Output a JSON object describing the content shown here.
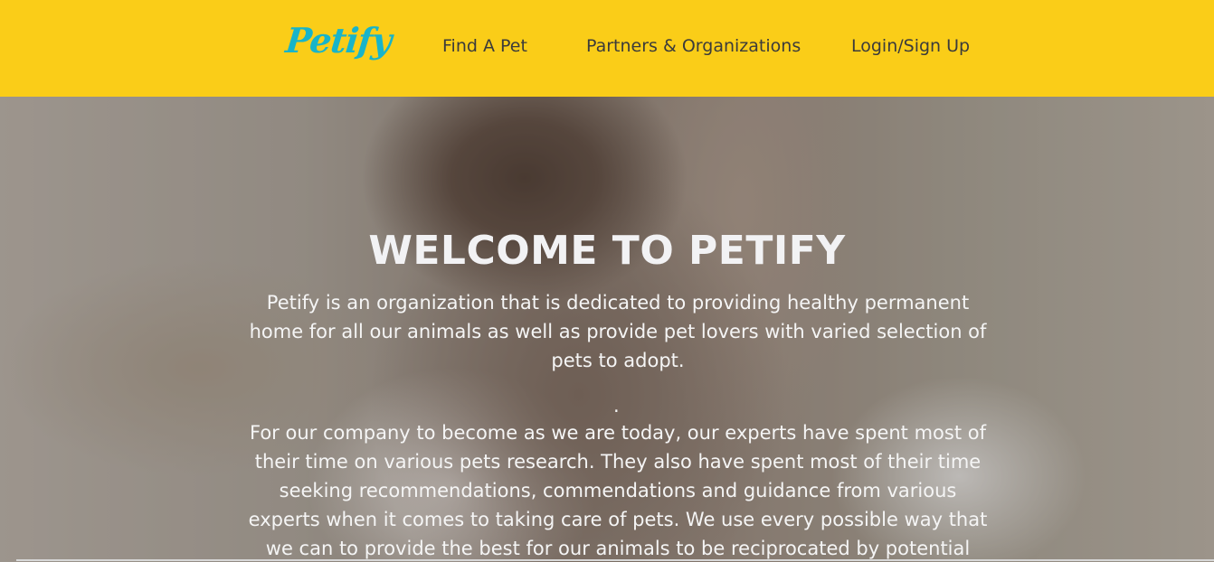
{
  "navbar": {
    "logo": "Petify",
    "links": [
      "Find A Pet",
      "Partners & Organizations",
      "Login/Sign Up"
    ],
    "background_color": "#facd18",
    "logo_color": "#18b4c9"
  },
  "hero": {
    "title": "WELCOME TO PETIFY",
    "paragraph_1": "Petify is an organization that is dedicated to providing healthy permanent home for all our animals as well as provide pet lovers with varied selection of pets to adopt.",
    "separator": ".",
    "paragraph_2": "For our company to become as we are today, our experts have spent most of their time on various pets research. They also have spent most of their time seeking recommendations, commendations and guidance from various experts when it comes to taking care of pets. We use every possible way that we can to provide the best for our animals to be reciprocated by potential"
  }
}
